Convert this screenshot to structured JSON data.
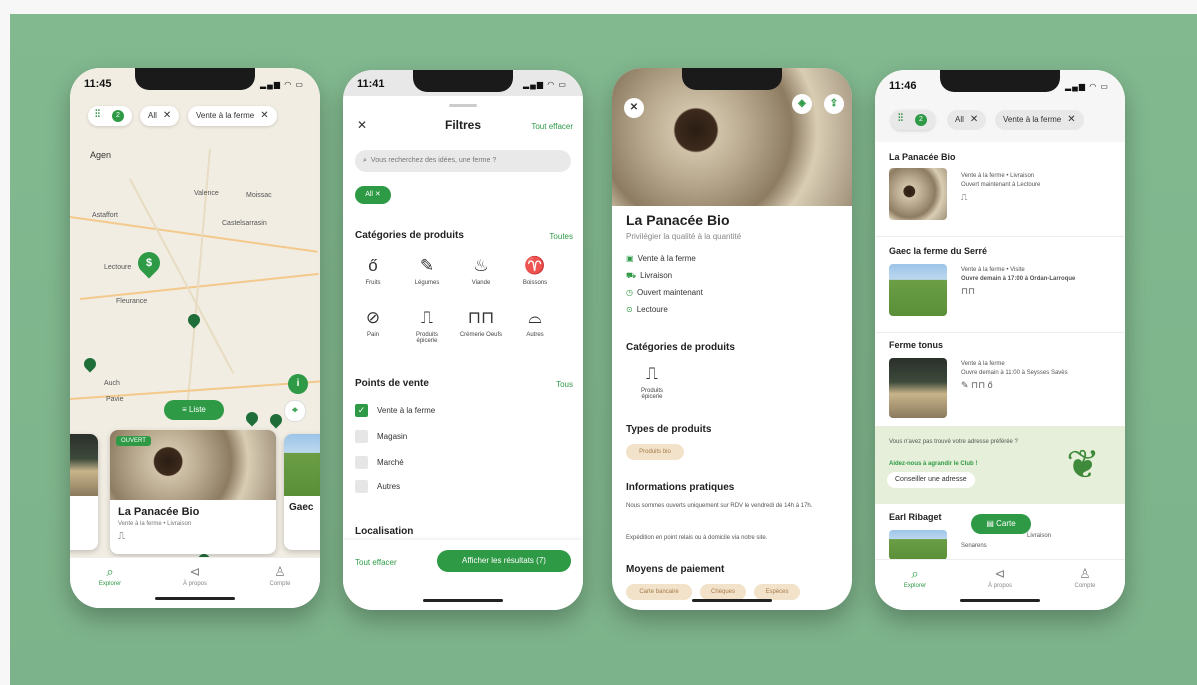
{
  "colors": {
    "accent": "#2e9a46",
    "backdrop": "#7db38a",
    "tan": "#f1e2c9"
  },
  "phone1": {
    "time": "11:45",
    "filter_count": "2",
    "chips": [
      "All",
      "Vente à la ferme"
    ],
    "places": [
      "Agen",
      "Valence",
      "Moissac",
      "Astaffort",
      "Castelsarrasin",
      "Lectoure",
      "Fleurance",
      "Auch",
      "Pavie"
    ],
    "list_button": "Liste",
    "card_badge": "OUVERT",
    "card_title": "La Panacée Bio",
    "card_subtitle": "Vente à la ferme • Livraison",
    "card2_title": "Gaec",
    "tabs": [
      "Explorer",
      "À propos",
      "Compte"
    ]
  },
  "phone2": {
    "time": "11:41",
    "title": "Filtres",
    "clear_top": "Tout effacer",
    "search_placeholder": "Vous recherchez des idées, une ferme ?",
    "selected_chip": "All",
    "cat_title": "Catégories de produits",
    "cat_all": "Toutes",
    "categories": [
      "Fruits",
      "Légumes",
      "Viande",
      "Boissons",
      "Pain",
      "Produits épicerie",
      "Crèmerie Oeufs",
      "Autres"
    ],
    "pv_title": "Points de vente",
    "pv_all": "Tous",
    "points": [
      "Vente à la ferme",
      "Magasin",
      "Marché",
      "Autres"
    ],
    "loc_title": "Localisation",
    "clear_bottom": "Tout effacer",
    "show_results": "Afficher les résultats (7)"
  },
  "phone3": {
    "title": "La Panacée Bio",
    "subtitle": "Privilégier la qualité à la quantité",
    "info": [
      "Vente à la ferme",
      "Livraison",
      "Ouvert maintenant",
      "Lectoure"
    ],
    "cat_title": "Catégories de produits",
    "cat_item": "Produits épicerie",
    "types_title": "Types de produits",
    "type_item": "Produits bio",
    "practical_title": "Informations pratiques",
    "practical_text1": "Nous sommes ouverts uniquement sur RDV le vendredi de 14h à 17h.",
    "practical_text2": "Expédition en point relais ou à domicile via notre site.",
    "payment_title": "Moyens de paiement",
    "payments": [
      "Carte bancaire",
      "Chèques",
      "Espèces"
    ]
  },
  "phone4": {
    "time": "11:46",
    "filter_count": "2",
    "chips": [
      "All",
      "Vente à la ferme"
    ],
    "items": [
      {
        "title": "La Panacée Bio",
        "line1": "Vente à la ferme • Livraison",
        "line2": "Ouvert maintenant à Lectoure"
      },
      {
        "title": "Gaec la ferme du Serré",
        "line1": "Vente à la ferme • Visite",
        "line2": "Ouvre demain à 17:00 à Ordan-Larroque"
      },
      {
        "title": "Ferme tonus",
        "line1": "Vente à la ferme",
        "line2": "Ouvre demain à 11:00 à Seysses Savès"
      }
    ],
    "promo_text": "Vous n'avez pas trouvé votre adresse préférée ?",
    "promo_link": "Aidez-nous à agrandir le Club !",
    "promo_button": "Conseiller une adresse",
    "last_title": "Earl Ribaget",
    "last_line": "Livraison",
    "last_place": "Senarens",
    "map_button": "Carte",
    "tabs": [
      "Explorer",
      "À propos",
      "Compte"
    ]
  }
}
